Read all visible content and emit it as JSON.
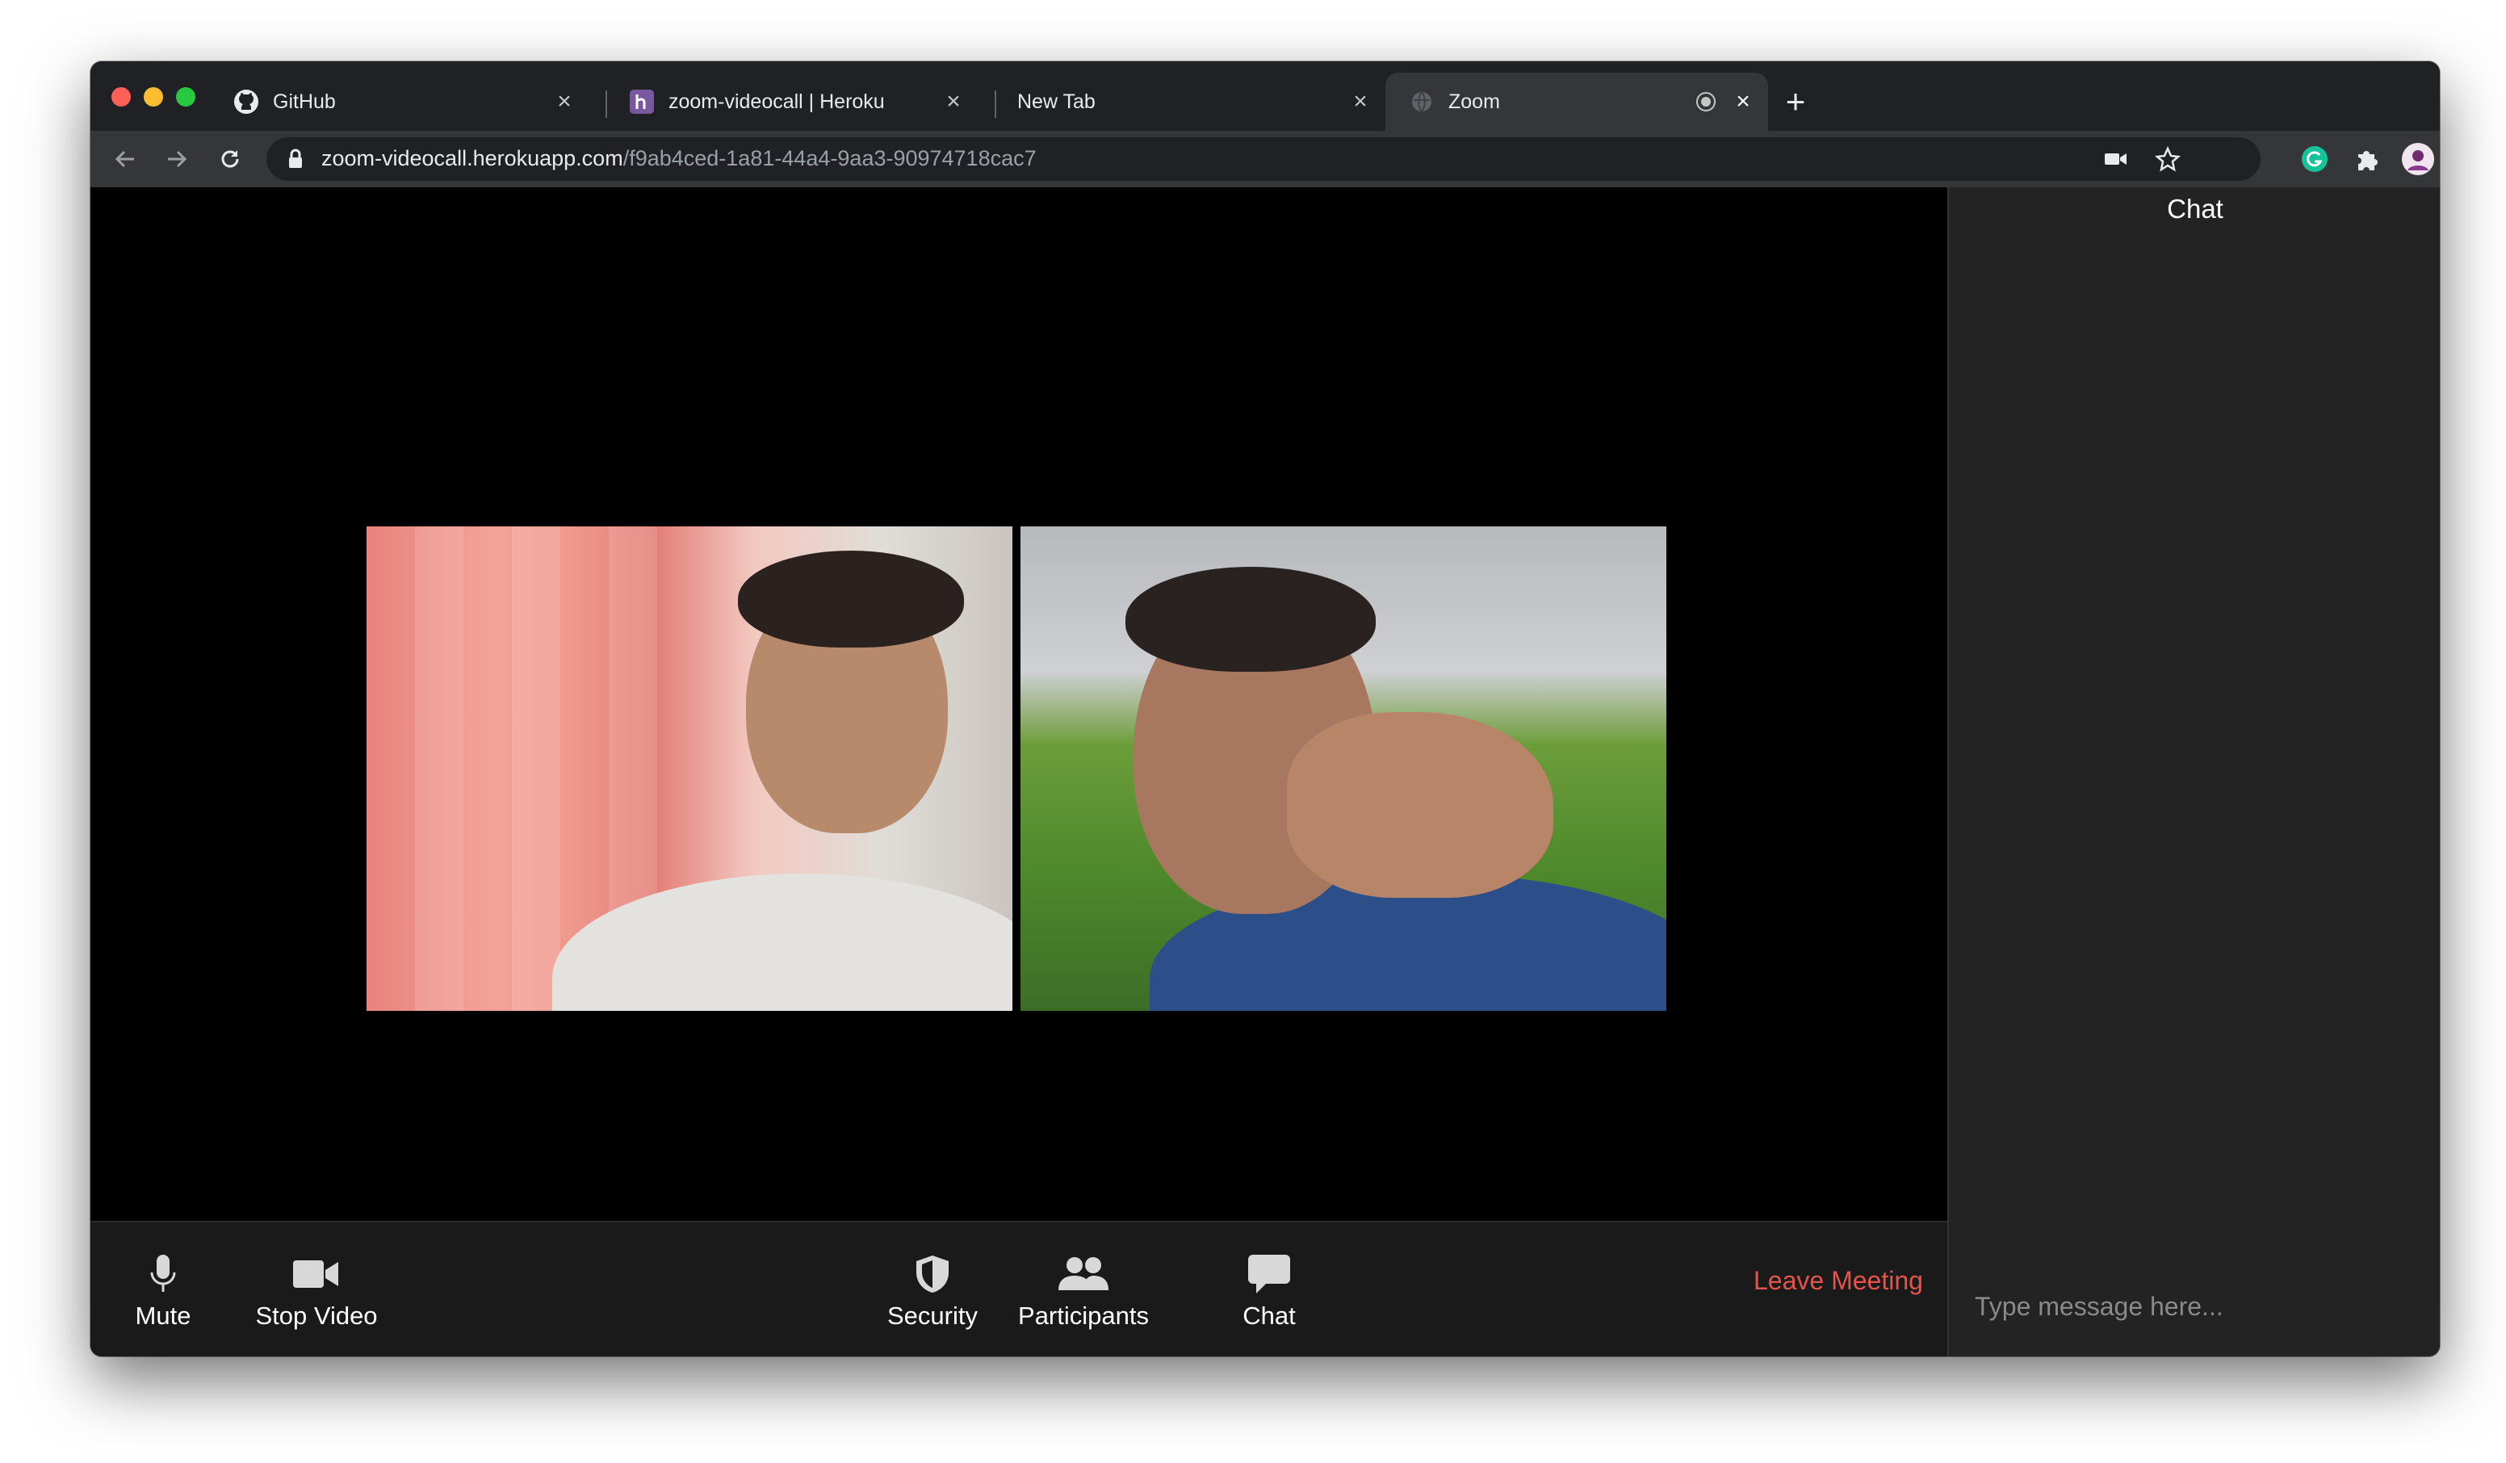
{
  "browser": {
    "tabs": [
      {
        "title": "GitHub",
        "favicon": "github-icon"
      },
      {
        "title": "zoom-videocall | Heroku",
        "favicon": "heroku-icon"
      },
      {
        "title": "New Tab",
        "favicon": ""
      },
      {
        "title": "Zoom",
        "favicon": "globe-icon",
        "active": true
      }
    ],
    "new_tab_label": "+",
    "close_glyph": "×",
    "url_host": "zoom-videocall.herokuapp.com",
    "url_path": "/f9ab4ced-1a81-44a4-9aa3-90974718cac7"
  },
  "toolbar": {
    "mute_label": "Mute",
    "stop_video_label": "Stop Video",
    "security_label": "Security",
    "participants_label": "Participants",
    "chat_label": "Chat",
    "leave_label": "Leave Meeting"
  },
  "chat": {
    "title": "Chat",
    "placeholder": "Type message here..."
  },
  "colors": {
    "leave": "#e5534b",
    "background": "#000000",
    "panel": "#232323"
  }
}
